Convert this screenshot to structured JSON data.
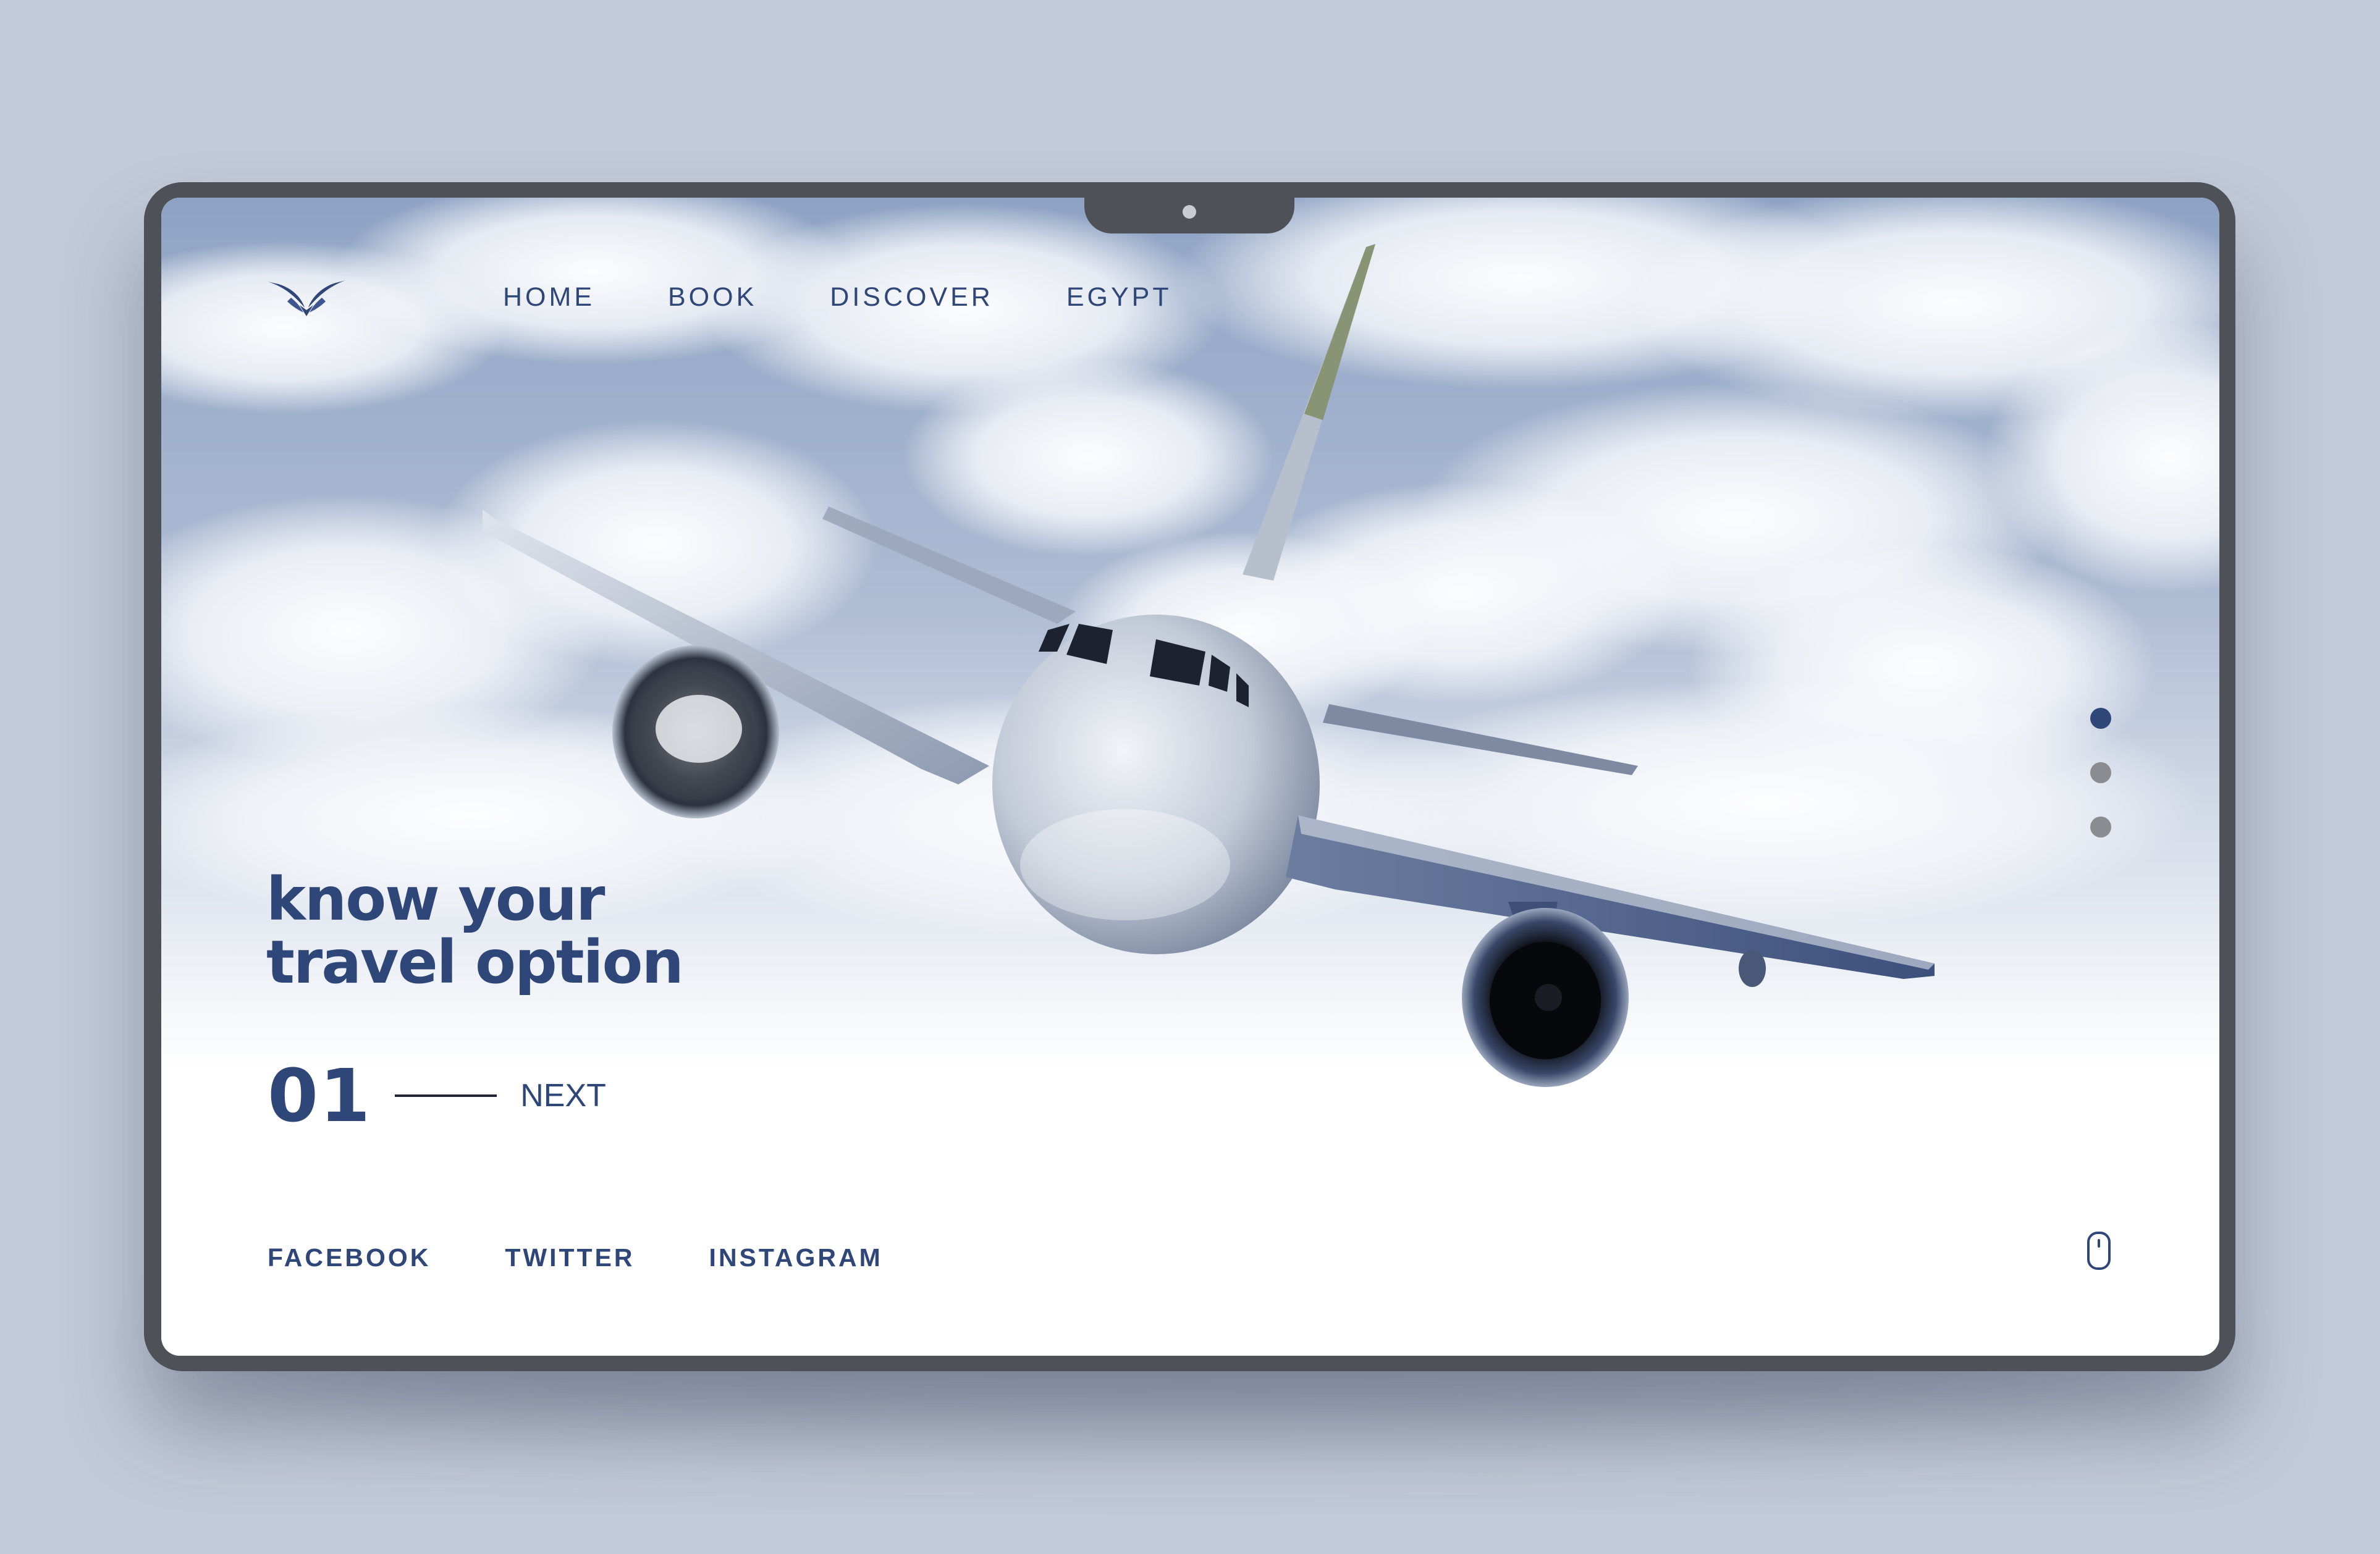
{
  "nav": {
    "items": [
      "HOME",
      "BOOK",
      "DISCOVER",
      "EGYPT"
    ]
  },
  "hero": {
    "headline_line1": "know your",
    "headline_line2": "travel option",
    "slide_number": "01",
    "next_label": "NEXT"
  },
  "social": {
    "items": [
      "FACEBOOK",
      "TWITTER",
      "INSTAGRAM"
    ]
  },
  "slider": {
    "total": 3,
    "active_index": 0
  },
  "icons": {
    "logo": "eagle-wings-logo",
    "scroll": "mouse-scroll-icon"
  },
  "colors": {
    "brand": "#2f4678",
    "background": "#c2c9d8",
    "bezel": "#4e5157",
    "inactive_dot": "#8a8c91"
  }
}
